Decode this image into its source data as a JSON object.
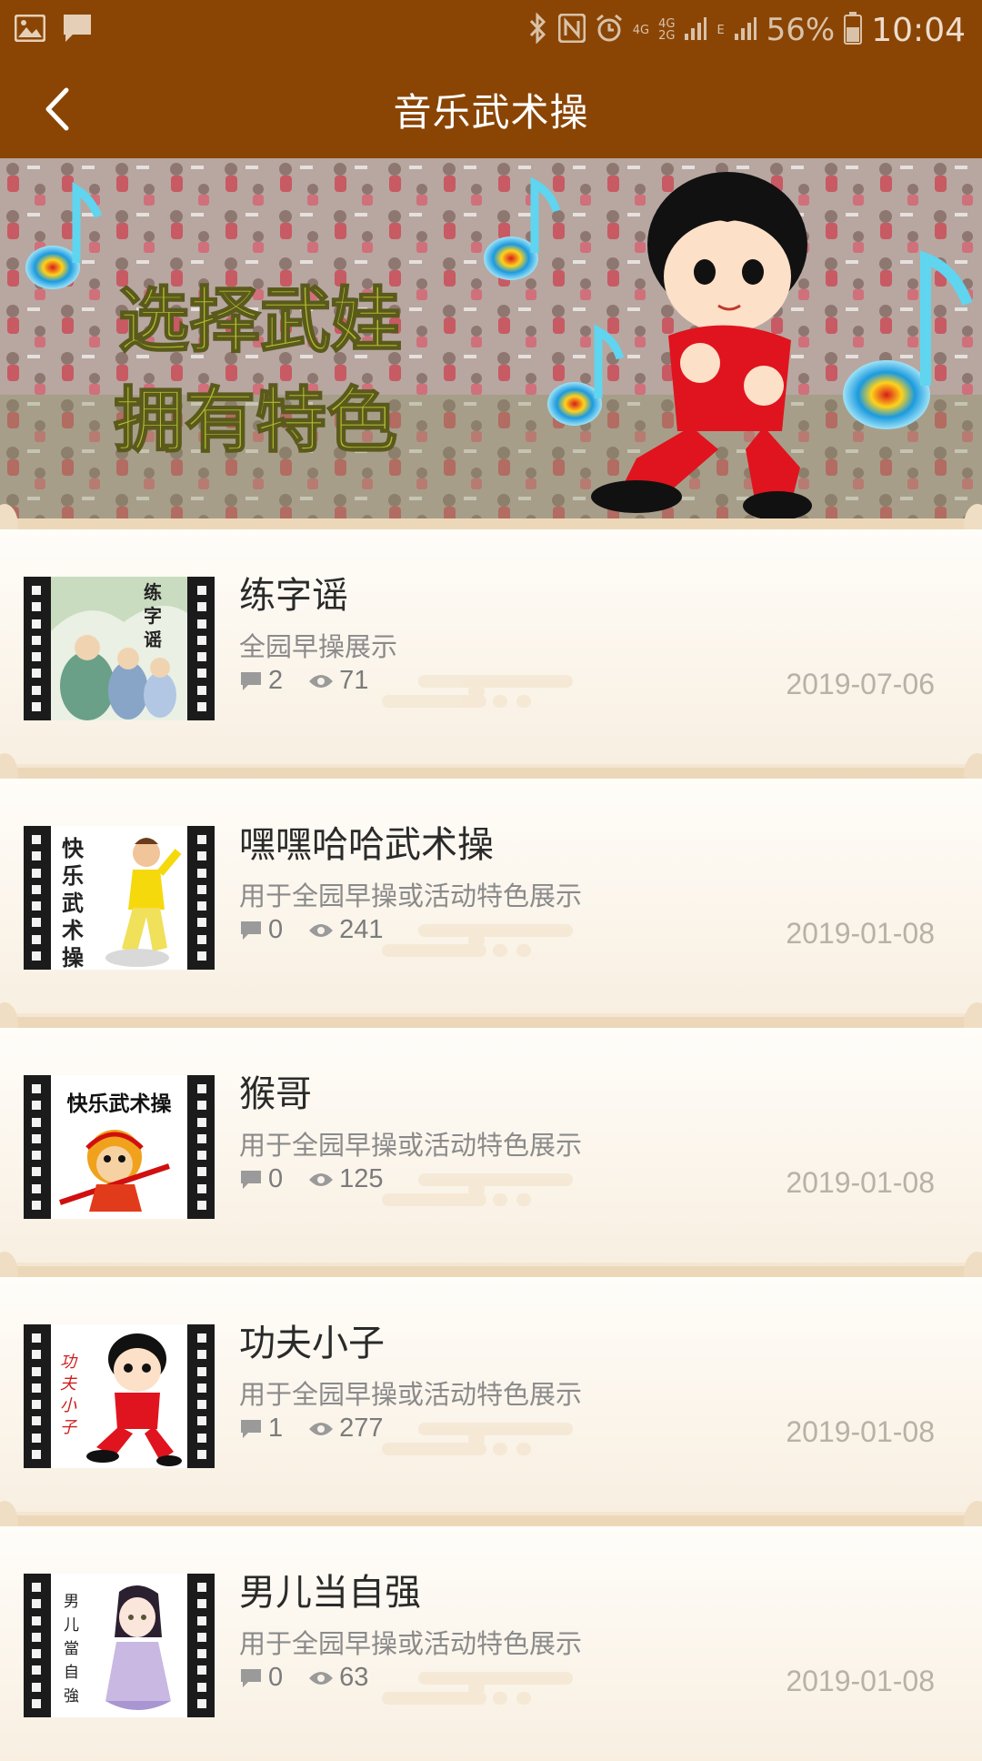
{
  "status_bar": {
    "battery": "56%",
    "time": "10:04",
    "net1": "4G",
    "net2": "4G",
    "net3": "2G",
    "net4": "E"
  },
  "header": {
    "title": "音乐武术操"
  },
  "banner": {
    "line1": "选择武娃",
    "line2": "拥有特色"
  },
  "items": [
    {
      "title": "练字谣",
      "subtitle": "全园早操展示",
      "comments": "2",
      "views": "71",
      "date": "2019-07-06",
      "thumb_text": "练字谣"
    },
    {
      "title": "嘿嘿哈哈武术操",
      "subtitle": " 用于全园早操或活动特色展示",
      "comments": "0",
      "views": "241",
      "date": "2019-01-08",
      "thumb_text": "快乐武术操"
    },
    {
      "title": "猴哥",
      "subtitle": "用于全园早操或活动特色展示",
      "comments": "0",
      "views": "125",
      "date": "2019-01-08",
      "thumb_text": "快乐武术操"
    },
    {
      "title": "功夫小子",
      "subtitle": "用于全园早操或活动特色展示",
      "comments": "1",
      "views": "277",
      "date": "2019-01-08",
      "thumb_text": "功夫小子"
    },
    {
      "title": "男儿当自强",
      "subtitle": "用于全园早操或活动特色展示",
      "comments": "0",
      "views": "63",
      "date": "2019-01-08",
      "thumb_text": "男儿當自強"
    }
  ],
  "colors": {
    "header_bg": "#8a4505",
    "page_bg": "#f4e6d2"
  }
}
